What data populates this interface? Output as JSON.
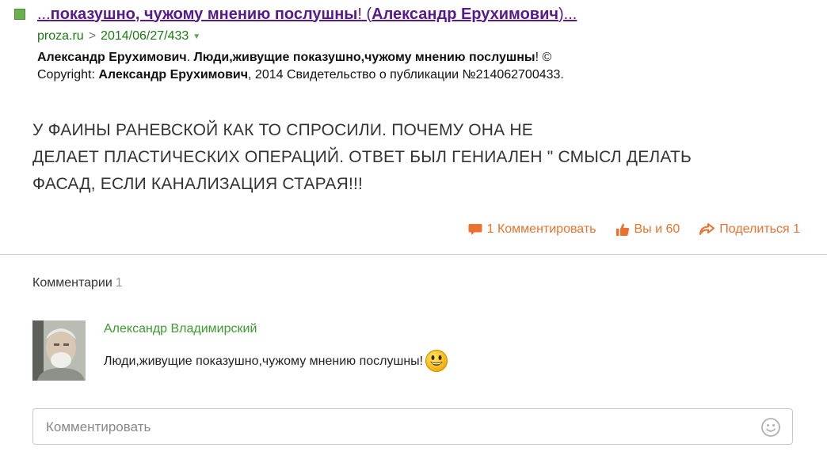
{
  "result": {
    "title_lead": "...",
    "title_main": "показушно, чужому мнению послушны",
    "title_mid": "! (",
    "title_author": "Александр Ерухимович",
    "title_tail": ")...",
    "url_domain": "proza.ru",
    "url_separator": ">",
    "url_path": "2014/06/27/433",
    "snippet_author1": "Александр Ерухимович",
    "snippet_dot": ". ",
    "snippet_title": "Люди,живущие показушно,чужому мнению послушны",
    "snippet_copyright": "! © Copyright: ",
    "snippet_author2": "Александр Ерухимович",
    "snippet_rest": ", 2014 Свидетельство о публикации №214062700433."
  },
  "post": {
    "line1": "У ФАИНЫ РАНЕВСКОЙ КАК ТО СПРОСИЛИ. ПОЧЕМУ ОНА НЕ",
    "line2": "ДЕЛАЕТ ПЛАСТИЧЕСКИХ ОПЕРАЦИЙ. ОТВЕТ БЫЛ ГЕНИАЛЕН \" СМЫСЛ ДЕЛАТЬ",
    "line3": "ФАСАД, ЕСЛИ КАНАЛИЗАЦИЯ СТАРАЯ!!!"
  },
  "actions": {
    "comment_label": "1 Комментировать",
    "like_label": "Вы и 60",
    "share_label": "Поделиться 1"
  },
  "comments": {
    "heading": "Комментарии",
    "count": "1",
    "items": [
      {
        "author": "Александр Владимирский",
        "text": "Люди,живущие показушно,чужому мнению послушны!"
      }
    ]
  },
  "comment_input": {
    "placeholder": "Комментировать",
    "value": ""
  },
  "colors": {
    "accent_orange": "#eb722e",
    "link_purple": "#551a8b",
    "url_green": "#1a7a12",
    "author_green": "#3c9a2e"
  },
  "icons": {
    "favicon": "favicon-square-icon",
    "url_dropdown": "triangle-down-icon",
    "comment": "speech-bubble-icon",
    "like": "thumbs-up-icon",
    "share": "share-arrow-icon",
    "smiley": "smiley-emoji-icon",
    "emoji_picker": "smiley-outline-icon"
  }
}
